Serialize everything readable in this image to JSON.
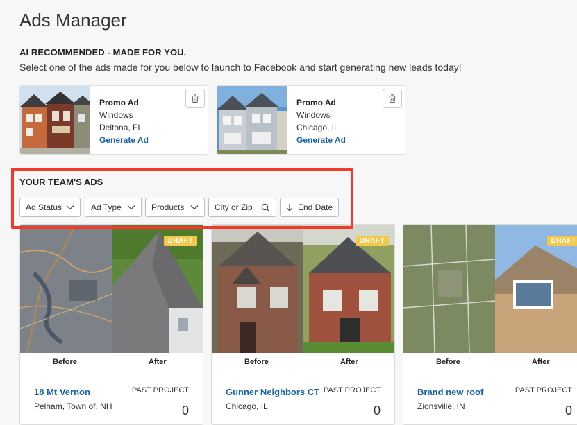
{
  "page": {
    "title": "Ads Manager"
  },
  "recommended": {
    "heading": "AI RECOMMENDED - MADE FOR YOU.",
    "subtitle": "Select one of the ads made for you below to launch to Facebook and start generating new leads today!",
    "cards": [
      {
        "title": "Promo Ad",
        "product": "Windows",
        "location": "Deltona, FL",
        "action": "Generate Ad"
      },
      {
        "title": "Promo Ad",
        "product": "Windows",
        "location": "Chicago, IL",
        "action": "Generate Ad"
      }
    ]
  },
  "team": {
    "heading": "YOUR TEAM'S ADS",
    "filters": {
      "status": "Ad Status",
      "type": "Ad Type",
      "products": "Products",
      "search_placeholder": "City or Zip",
      "sort": "End Date"
    },
    "before_label": "Before",
    "after_label": "After",
    "ads": [
      {
        "badge": "DRAFT",
        "title": "18 Mt Vernon",
        "location": "Pelham, Town of, NH",
        "type": "PAST PROJECT",
        "count": "0"
      },
      {
        "badge": "DRAFT",
        "title": "Gunner Neighbors CT",
        "location": "Chicago, IL",
        "type": "PAST PROJECT",
        "count": "0"
      },
      {
        "badge": "DRAFT",
        "title": "Brand new roof",
        "location": "Zionsville, IN",
        "type": "PAST PROJECT",
        "count": "0"
      }
    ]
  },
  "colors": {
    "link": "#1b64a8",
    "highlight": "#f03a2c",
    "draft_badge": "#f2c94c",
    "background": "#f7f7f7"
  }
}
